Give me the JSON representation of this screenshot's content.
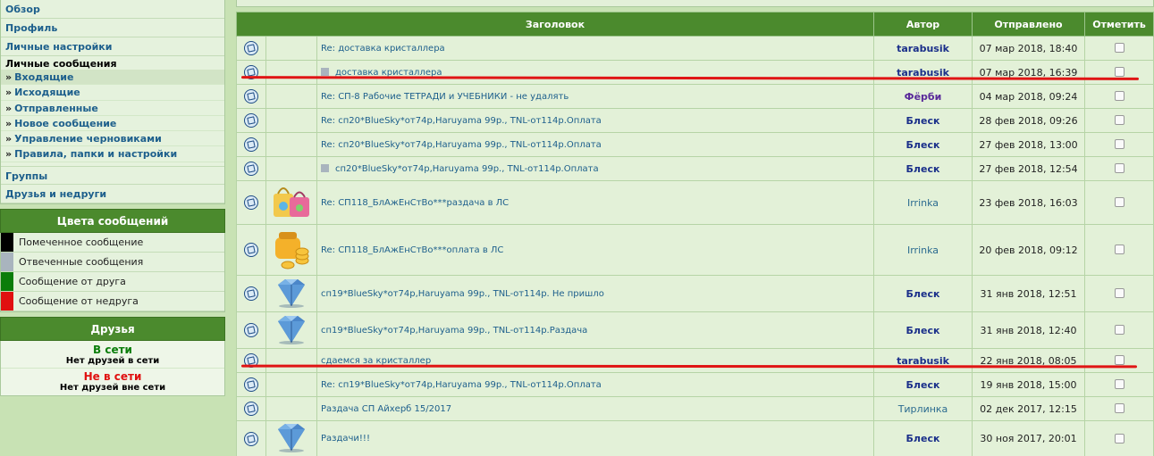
{
  "nav": {
    "overview": "Обзор",
    "profile": "Профиль",
    "personal_settings": "Личные настройки",
    "pm_header": "Личные сообщения",
    "pm_items": [
      {
        "label": "Входящие"
      },
      {
        "label": "Исходящие"
      },
      {
        "label": "Отправленные"
      },
      {
        "label": "Новое сообщение"
      },
      {
        "label": "Управление черновиками"
      },
      {
        "label": "Правила, папки и настройки"
      }
    ],
    "arrow": "»",
    "groups": "Группы",
    "friends_foes": "Друзья и недруги"
  },
  "colors_box": {
    "title": "Цвета сообщений",
    "items": [
      {
        "label": "Помеченное сообщение",
        "color": "#000000"
      },
      {
        "label": "Отвеченные сообщения",
        "color": "#a9b4be"
      },
      {
        "label": "Сообщение от друга",
        "color": "#0a7d0a"
      },
      {
        "label": "Сообщение от недруга",
        "color": "#e01010"
      }
    ]
  },
  "friends_box": {
    "title": "Друзья",
    "online_label": "В сети",
    "online_text": "Нет друзей в сети",
    "offline_label": "Не в сети",
    "offline_text": "Нет друзей вне сети"
  },
  "table": {
    "headers": {
      "title": "Заголовок",
      "author": "Автор",
      "sent": "Отправлено",
      "mark": "Отметить"
    },
    "rows": [
      {
        "title": "Re: доставка кристаллера",
        "author": "tarabusik",
        "date": "07 мар 2018, 18:40",
        "img": "",
        "sq": false
      },
      {
        "title": "доставка кристаллера",
        "author": "tarabusik",
        "date": "07 мар 2018, 16:39",
        "img": "",
        "sq": true
      },
      {
        "title": "Re: СП-8 Рабочие ТЕТРАДИ и УЧЕБНИКИ - не удалять",
        "author": "Фёрби",
        "date": "04 мар 2018, 09:24",
        "img": "",
        "sq": false
      },
      {
        "title": "Re: сп20*BlueSky*от74р,Haruyama 99р., TNL-от114р.Оплата",
        "author": "Блеск",
        "date": "28 фев 2018, 09:26",
        "img": "",
        "sq": false
      },
      {
        "title": "Re: сп20*BlueSky*от74р,Haruyama 99р., TNL-от114р.Оплата",
        "author": "Блеск",
        "date": "27 фев 2018, 13:00",
        "img": "",
        "sq": false
      },
      {
        "title": "сп20*BlueSky*от74р,Haruyama 99р., TNL-от114р.Оплата",
        "author": "Блеск",
        "date": "27 фев 2018, 12:54",
        "img": "",
        "sq": true
      },
      {
        "title": "Re: СП118_БлАжЕнСтВо***раздача в ЛС",
        "author": "Irrinka",
        "date": "23 фев 2018, 16:03",
        "img": "bags",
        "sq": false
      },
      {
        "title": "Re: СП118_БлАжЕнСтВо***оплата в ЛС",
        "author": "Irrinka",
        "date": "20 фев 2018, 09:12",
        "img": "coins",
        "sq": false
      },
      {
        "title": "сп19*BlueSky*от74р,Haruyama 99р., TNL-от114р. Не пришло",
        "author": "Блеск",
        "date": "31 янв 2018, 12:51",
        "img": "diamond",
        "sq": false
      },
      {
        "title": "сп19*BlueSky*от74р,Haruyama 99р., TNL-от114р.Раздача",
        "author": "Блеск",
        "date": "31 янв 2018, 12:40",
        "img": "diamond",
        "sq": false
      },
      {
        "title": "сдаемся за кристаллер",
        "author": "tarabusik",
        "date": "22 янв 2018, 08:05",
        "img": "",
        "sq": false
      },
      {
        "title": "Re: сп19*BlueSky*от74р,Haruyama 99р., TNL-от114р.Оплата",
        "author": "Блеск",
        "date": "19 янв 2018, 15:00",
        "img": "",
        "sq": false
      },
      {
        "title": "Раздача СП Айхерб 15/2017",
        "author": "Тирлинка",
        "date": "02 дек 2017, 12:15",
        "img": "",
        "sq": false
      },
      {
        "title": "Раздачи!!!",
        "author": "Блеск",
        "date": "30 ноя 2017, 20:01",
        "img": "diamond",
        "sq": false
      }
    ]
  }
}
